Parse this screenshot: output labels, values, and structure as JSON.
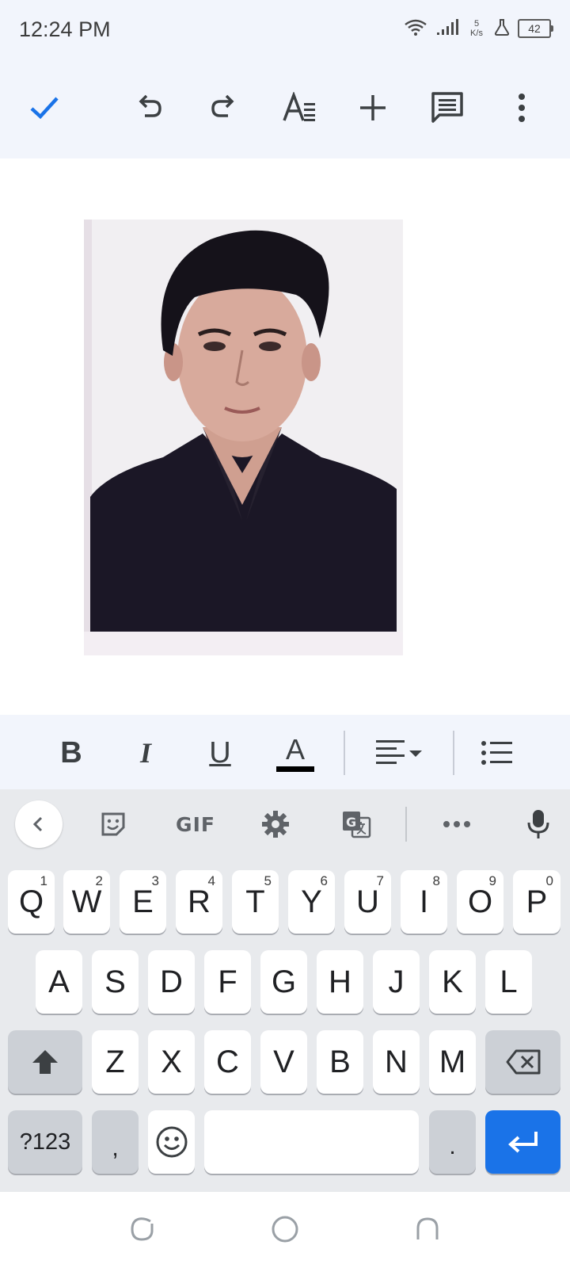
{
  "status": {
    "time": "12:24 PM",
    "net_speed_value": "5",
    "net_speed_unit": "K/s",
    "battery": "42"
  },
  "toolbar": {
    "items": [
      "checkmark-icon",
      "undo-icon",
      "redo-icon",
      "text-format-icon",
      "add-icon",
      "comment-icon",
      "more-vert-icon"
    ]
  },
  "format_bar": {
    "bold": "B",
    "italic": "I",
    "underline": "U",
    "text_color_glyph": "A",
    "text_color": "#000000"
  },
  "keyboard": {
    "tools": {
      "gif_label": "GIF"
    },
    "row1": [
      {
        "label": "Q",
        "hint": "1"
      },
      {
        "label": "W",
        "hint": "2"
      },
      {
        "label": "E",
        "hint": "3"
      },
      {
        "label": "R",
        "hint": "4"
      },
      {
        "label": "T",
        "hint": "5"
      },
      {
        "label": "Y",
        "hint": "6"
      },
      {
        "label": "U",
        "hint": "7"
      },
      {
        "label": "I",
        "hint": "8"
      },
      {
        "label": "O",
        "hint": "9"
      },
      {
        "label": "P",
        "hint": "0"
      }
    ],
    "row2": [
      "A",
      "S",
      "D",
      "F",
      "G",
      "H",
      "J",
      "K",
      "L"
    ],
    "row3": [
      "Z",
      "X",
      "C",
      "V",
      "B",
      "N",
      "M"
    ],
    "symbols_key": "?123",
    "comma_key": ",",
    "period_key": ".",
    "enter_color": "#1a73e8"
  },
  "colors": {
    "accent": "#1a73e8",
    "toolbar_bg": "#f2f5fc",
    "keyboard_bg": "#e8eaed"
  }
}
